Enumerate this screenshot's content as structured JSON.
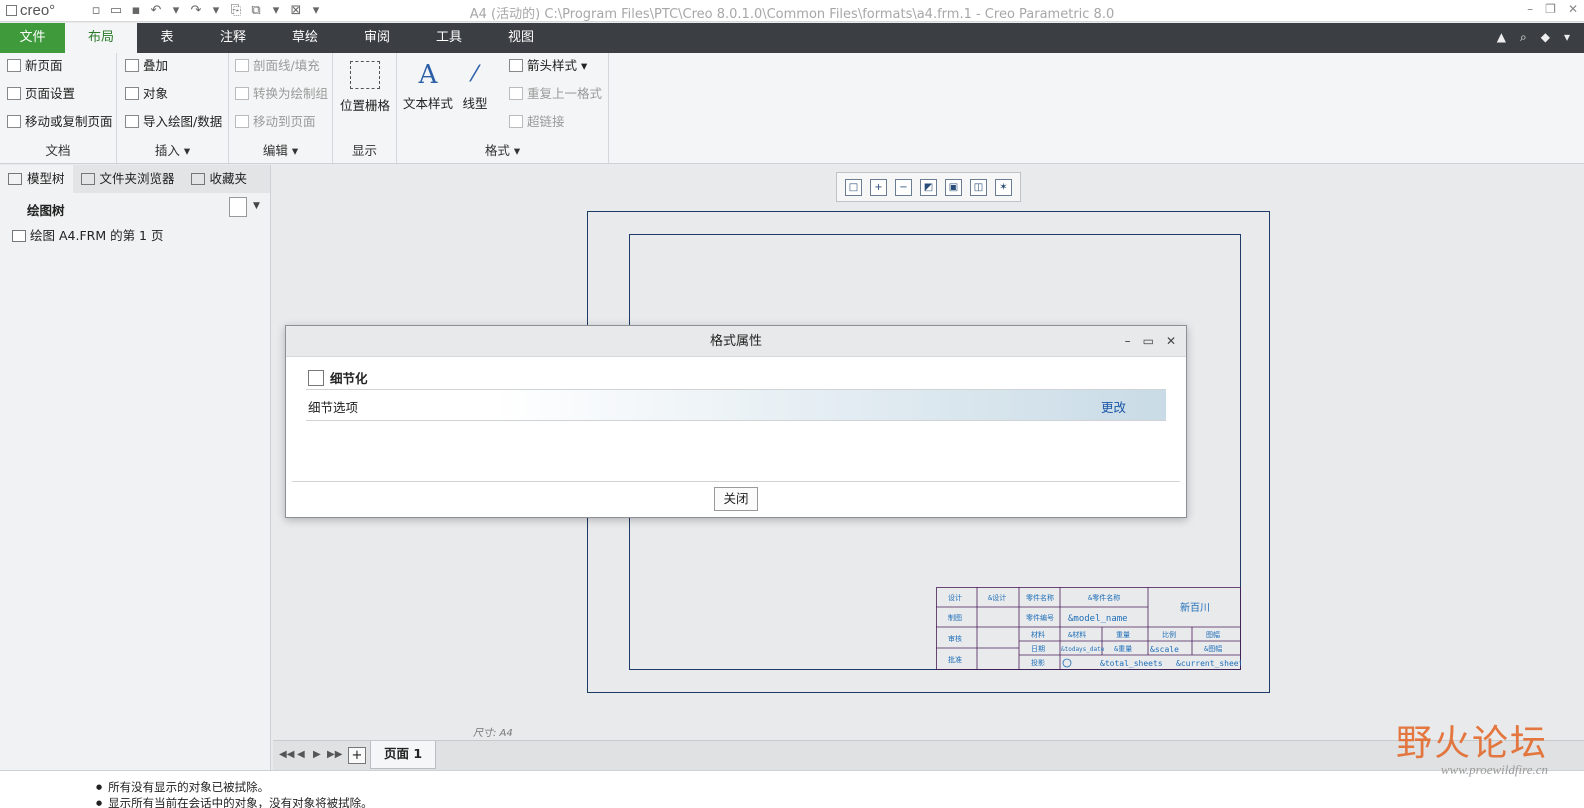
{
  "app": {
    "logo": "creo°",
    "window_title": "A4 (活动的) C:\\Program Files\\PTC\\Creo 8.0.1.0\\Common Files\\formats\\a4.frm.1 - Creo Parametric 8.0"
  },
  "ribbon_tabs": [
    "文件",
    "布局",
    "表",
    "注释",
    "草绘",
    "审阅",
    "工具",
    "视图"
  ],
  "ribbon": {
    "document": {
      "label": "文档",
      "items": [
        "新页面",
        "页面设置",
        "移动或复制页面"
      ]
    },
    "insert": {
      "label": "插入",
      "items": [
        "叠加",
        "对象",
        "导入绘图/数据"
      ]
    },
    "edit": {
      "label": "编辑",
      "items": [
        "剖面线/填充",
        "转换为绘制组",
        "移动到页面"
      ]
    },
    "display": {
      "label": "显示",
      "button": "位置栅格"
    },
    "format": {
      "label": "格式",
      "text_style": "文本样式",
      "line_style": "线型",
      "items": [
        "箭头样式",
        "重复上一格式",
        "超链接"
      ]
    }
  },
  "left_panel": {
    "tabs": [
      "模型树",
      "文件夹浏览器",
      "收藏夹"
    ],
    "tree_header": "绘图树",
    "tree_item": "绘图 A4.FRM 的第 1 页"
  },
  "canvas": {
    "scale_note": "尺寸: A4",
    "title_block": {
      "r1": [
        "设计",
        "&设计",
        "零件名称",
        "&零件名称",
        "新百川"
      ],
      "r2": [
        "制图",
        "零件编号",
        "&model_name"
      ],
      "r3": [
        "审核",
        "材料",
        "&材料",
        "重量",
        "比例",
        "图幅"
      ],
      "r4": [
        "批准",
        "日期",
        "&todays_date",
        "&重量",
        "&scale",
        "&图幅"
      ],
      "r5": [
        "投影",
        "&total_sheets",
        "&current_sheet",
        "张"
      ]
    }
  },
  "page_bar": {
    "page_tab": "页面 1"
  },
  "status": {
    "messages": [
      "所有没有显示的对象已被拭除。",
      "显示所有当前在会话中的对象，没有对象将被拭除。"
    ]
  },
  "watermark": {
    "text": "野火论坛",
    "url": "www.proewildfire.cn"
  },
  "dialog": {
    "title": "格式属性",
    "section": "细节化",
    "row_label": "细节选项",
    "change_link": "更改",
    "close_button": "关闭"
  }
}
